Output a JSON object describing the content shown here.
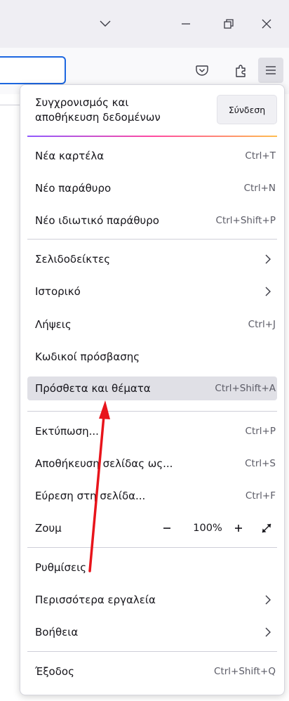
{
  "titlebar": {
    "icons": [
      "chevron-down-icon",
      "minimize-icon",
      "restore-icon",
      "close-icon"
    ]
  },
  "toolbar": {
    "icons": [
      "pocket-icon",
      "extensions-icon",
      "hamburger-menu-icon"
    ]
  },
  "menu": {
    "sync": {
      "line1": "Συγχρονισμός και",
      "line2": "αποθήκευση δεδομένων",
      "signin_label": "Σύνδεση"
    },
    "items": {
      "new_tab": {
        "label": "Νέα καρτέλα",
        "shortcut": "Ctrl+T"
      },
      "new_window": {
        "label": "Νέο παράθυρο",
        "shortcut": "Ctrl+N"
      },
      "private_window": {
        "label": "Νέο ιδιωτικό παράθυρο",
        "shortcut": "Ctrl+Shift+P"
      },
      "bookmarks": {
        "label": "Σελιδοδείκτες"
      },
      "history": {
        "label": "Ιστορικό"
      },
      "downloads": {
        "label": "Λήψεις",
        "shortcut": "Ctrl+J"
      },
      "passwords": {
        "label": "Κωδικοί πρόσβασης"
      },
      "addons": {
        "label": "Πρόσθετα και θέματα",
        "shortcut": "Ctrl+Shift+A"
      },
      "print": {
        "label": "Εκτύπωση...",
        "shortcut": "Ctrl+P"
      },
      "save_page": {
        "label": "Αποθήκευση σελίδας ως...",
        "shortcut": "Ctrl+S"
      },
      "find": {
        "label": "Εύρεση στη σελίδα...",
        "shortcut": "Ctrl+F"
      },
      "zoom": {
        "label": "Ζουμ",
        "value": "100%",
        "minus": "−",
        "plus": "+"
      },
      "settings": {
        "label": "Ρυθμίσεις"
      },
      "more_tools": {
        "label": "Περισσότερα εργαλεία"
      },
      "help": {
        "label": "Βοήθεια"
      },
      "exit": {
        "label": "Έξοδος",
        "shortcut": "Ctrl+Shift+Q"
      }
    },
    "hovered_item": "addons"
  },
  "colors": {
    "titlebar_bg": "#efeef3",
    "hover_bg": "#e0e0e6",
    "urlbar_focus": "#1d67e0",
    "annotation": "#e8141b"
  }
}
